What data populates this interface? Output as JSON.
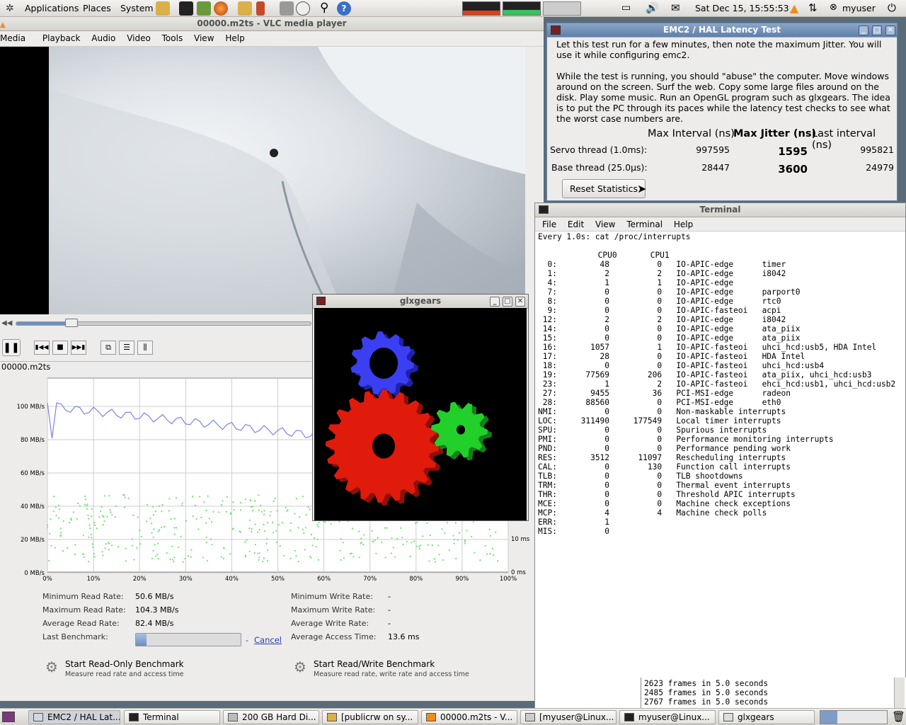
{
  "top_panel": {
    "menus": [
      "Applications",
      "Places",
      "System"
    ],
    "clock": "Sat Dec 15, 15:55:53",
    "user": "myuser"
  },
  "vlc": {
    "title": "00000.m2ts - VLC media player",
    "menus": [
      "Media",
      "Playback",
      "Audio",
      "Video",
      "Tools",
      "View",
      "Help"
    ],
    "status_file": "00000.m2ts",
    "seek_fraction": 0.19
  },
  "disk": {
    "y_ticks": [
      "100 MB/s",
      "80 MB/s",
      "60 MB/s",
      "40 MB/s",
      "20 MB/s",
      "0 MB/s"
    ],
    "x_ticks": [
      "0%",
      "10%",
      "20%",
      "30%",
      "40%",
      "50%",
      "60%",
      "70%",
      "80%",
      "90%",
      "100%"
    ],
    "y2_ticks": [
      "10 ms",
      "0 ms"
    ],
    "stats_left": [
      {
        "label": "Minimum Read Rate:",
        "value": "50.6 MB/s"
      },
      {
        "label": "Maximum Read Rate:",
        "value": "104.3 MB/s"
      },
      {
        "label": "Average Read Rate:",
        "value": "82.4 MB/s"
      },
      {
        "label": "Last Benchmark:",
        "value": ""
      }
    ],
    "stats_right": [
      {
        "label": "Minimum Write Rate:",
        "value": "-"
      },
      {
        "label": "Maximum Write Rate:",
        "value": "-"
      },
      {
        "label": "Average Write Rate:",
        "value": "-"
      },
      {
        "label": "Average Access Time:",
        "value": "13.6 ms"
      }
    ],
    "progress_fraction": 0.1,
    "dash": "-",
    "cancel": "Cancel",
    "btn_ro_title": "Start Read-Only Benchmark",
    "btn_ro_sub": "Measure read rate and access time",
    "btn_rw_title": "Start Read/Write Benchmark",
    "btn_rw_sub": "Measure read rate, write rate and access time"
  },
  "emc": {
    "title": "EMC2 / HAL Latency Test",
    "p1": "Let this test run for a few minutes, then note the maximum Jitter.  You will use it while configuring emc2.",
    "p2": "While the test is running, you should \"abuse\" the computer. Move windows around on the screen. Surf the web. Copy some large files around on the disk. Play some music. Run an OpenGL program such as glxgears. The idea is to put the PC through its paces while the latency test checks to see what the worst case numbers are.",
    "h_max": "Max Interval (ns)",
    "h_jit": "Max Jitter (ns)",
    "h_last": "Last interval (ns)",
    "rows": [
      {
        "label": "Servo thread (1.0ms):",
        "max": "997595",
        "jitter": "1595",
        "last": "995821"
      },
      {
        "label": "Base thread (25.0µs):",
        "max": "28447",
        "jitter": "3600",
        "last": "24979"
      }
    ],
    "reset": "Reset Statistics"
  },
  "terminal": {
    "title": "Terminal",
    "menus": [
      "File",
      "Edit",
      "View",
      "Terminal",
      "Help"
    ],
    "cmd": "Every 1.0s: cat /proc/interrupts",
    "header": "         CPU0       CPU1",
    "lines": [
      "  0:         48          0   IO-APIC-edge      timer",
      "  1:          2          2   IO-APIC-edge      i8042",
      "  4:          1          1   IO-APIC-edge",
      "  7:          0          0   IO-APIC-edge      parport0",
      "  8:          0          0   IO-APIC-edge      rtc0",
      "  9:          0          0   IO-APIC-fasteoi   acpi",
      " 12:          2          2   IO-APIC-edge      i8042",
      " 14:          0          0   IO-APIC-edge      ata_piix",
      " 15:          0          0   IO-APIC-edge      ata_piix",
      " 16:       1057          1   IO-APIC-fasteoi   uhci_hcd:usb5, HDA Intel",
      " 17:         28          0   IO-APIC-fasteoi   HDA Intel",
      " 18:          0          0   IO-APIC-fasteoi   uhci_hcd:usb4",
      " 19:      77569        206   IO-APIC-fasteoi   ata_piix, uhci_hcd:usb3",
      " 23:          1          2   IO-APIC-fasteoi   ehci_hcd:usb1, uhci_hcd:usb2",
      " 27:       9455         36   PCI-MSI-edge      radeon",
      " 28:      88560          0   PCI-MSI-edge      eth0",
      "NMI:          0          0   Non-maskable interrupts",
      "LOC:     311490     177549   Local timer interrupts",
      "SPU:          0          0   Spurious interrupts",
      "PMI:          0          0   Performance monitoring interrupts",
      "PND:          0          0   Performance pending work",
      "RES:       3512      11097   Rescheduling interrupts",
      "CAL:          0        130   Function call interrupts",
      "TLB:          0          0   TLB shootdowns",
      "TRM:          0          0   Thermal event interrupts",
      "THR:          0          0   Threshold APIC interrupts",
      "MCE:          0          0   Machine check exceptions",
      "MCP:          4          4   Machine check polls",
      "ERR:          1",
      "MIS:          0"
    ],
    "frames": [
      "2623 frames in 5.0 seconds",
      "2485 frames in 5.0 seconds",
      "2767 frames in 5.0 seconds"
    ]
  },
  "glx": {
    "title": "glxgears"
  },
  "taskbar": [
    "EMC2 / HAL Lat...",
    "Terminal",
    "200 GB Hard Di...",
    "[publicrw on sy...",
    "00000.m2ts - V...",
    "[myuser@Linux...",
    "myuser@Linux...",
    "glxgears"
  ]
}
